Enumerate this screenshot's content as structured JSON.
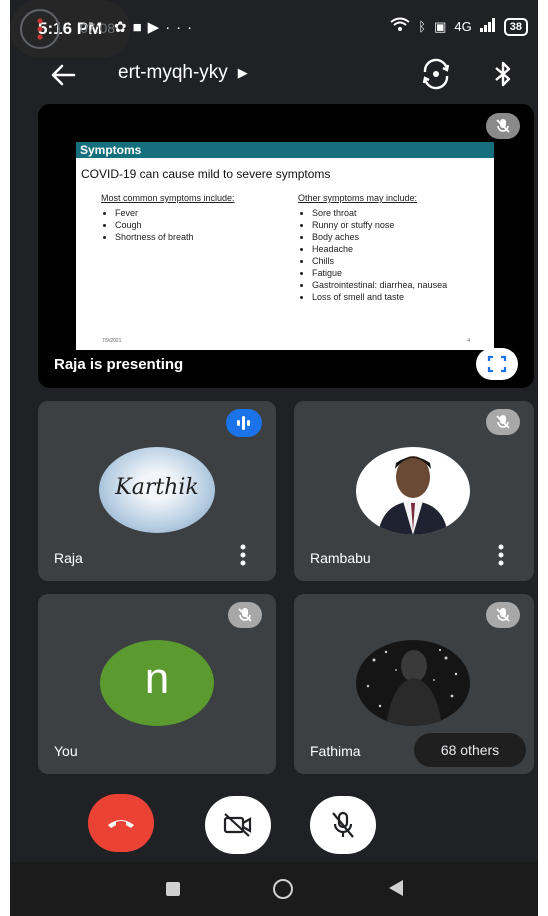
{
  "status_bar": {
    "time": "5:16 PM",
    "left_icons": [
      "gear-icon",
      "video-icon",
      "play-icon",
      "more-dots"
    ],
    "network": "4G",
    "battery": "38"
  },
  "header": {
    "meeting_code": "ert-myqh-yky",
    "icons": [
      "back-arrow-icon",
      "switch-camera-icon",
      "bluetooth-icon"
    ]
  },
  "presentation": {
    "presenting_label": "Raja is presenting",
    "slide": {
      "title": "Symptoms",
      "subtitle": "COVID-19 can cause mild to severe symptoms",
      "left_heading": "Most common symptoms include:",
      "left_items": [
        "Fever",
        "Cough",
        "Shortness of breath"
      ],
      "right_heading": "Other symptoms may include:",
      "right_items": [
        "Sore throat",
        "Runny or stuffy nose",
        "Body aches",
        "Headache",
        "Chills",
        "Fatigue",
        "Gastrointestinal: diarrhea, nausea",
        "Loss of smell and taste"
      ],
      "date": "7/9/2021",
      "page": "4"
    }
  },
  "participants": [
    {
      "name": "Raja",
      "avatar_text": "Karthik",
      "status": "speaking"
    },
    {
      "name": "Rambabu",
      "status": "muted"
    },
    {
      "name": "You",
      "avatar_letter": "n",
      "status": "muted"
    },
    {
      "name": "Fathima",
      "status": "muted",
      "others": "68 others"
    }
  ],
  "controls": {
    "timer": "07:08",
    "icons": [
      "end-call-icon",
      "camera-off-icon",
      "mic-off-icon",
      "more-options-icon"
    ]
  },
  "colors": {
    "end_call": "#ea4335",
    "speaking": "#1a73e8",
    "avatar_green": "#5b9a2f",
    "slide_header": "#156f7d",
    "tile_bg": "#3c4043"
  }
}
